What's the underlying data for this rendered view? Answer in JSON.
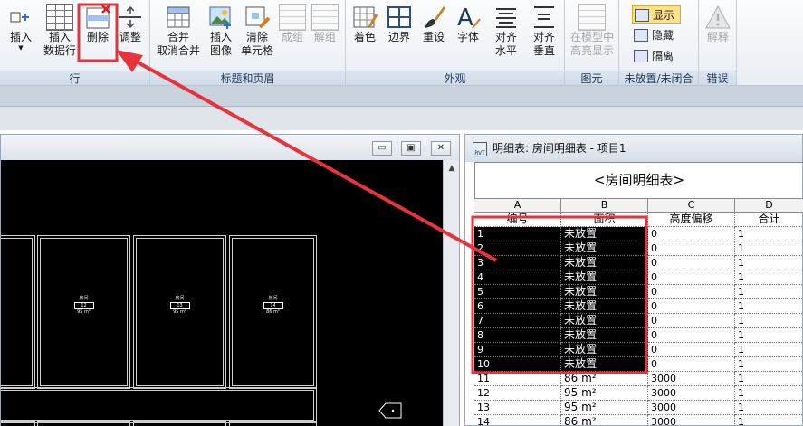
{
  "ribbon": {
    "groups": {
      "row": "行",
      "titles_headers": "标题和页眉",
      "appearance": "外观",
      "element": "图元",
      "unplaced": "未放置/未闭合",
      "error": "错误"
    },
    "buttons": {
      "insert": "插入",
      "insert_data_row_1": "插入",
      "insert_data_row_2": "数据行",
      "delete": "删除",
      "adjust": "调整",
      "merge_1": "合并",
      "merge_2": "取消合并",
      "insert_image_1": "插入",
      "insert_image_2": "图像",
      "clear_cell_1": "清除",
      "clear_cell_2": "单元格",
      "group": "成组",
      "ungroup": "解组",
      "shading": "着色",
      "borders": "边界",
      "reset": "重设",
      "font": "字体",
      "align_h_1": "对齐",
      "align_h_2": "水平",
      "align_v_1": "对齐",
      "align_v_2": "垂直",
      "highlight_model_1": "在模型中",
      "highlight_model_2": "高亮显示",
      "show": "显示",
      "hide": "隐藏",
      "isolate": "隔离",
      "explain": "解释"
    }
  },
  "view_window": {
    "buttons": {
      "minimize": "▭",
      "restore": "▣",
      "close": "✕"
    },
    "room_tags": [
      {
        "name": "房间",
        "number": "12",
        "area": "95 m²"
      },
      {
        "name": "房间",
        "number": "13",
        "area": "95 m²"
      },
      {
        "name": "房间",
        "number": "14",
        "area": "86 m²"
      }
    ]
  },
  "schedule": {
    "window_title": "明细表: 房间明细表 - 项目1",
    "icon_label": "RVT",
    "heading": "<房间明细表>",
    "column_letters": [
      "A",
      "B",
      "C",
      "D"
    ],
    "column_headers": [
      "编号",
      "面积",
      "高度偏移",
      "合计"
    ],
    "rows": [
      {
        "num": "1",
        "area": "未放置",
        "offset": "0",
        "count": "1",
        "selected": true
      },
      {
        "num": "2",
        "area": "未放置",
        "offset": "0",
        "count": "1",
        "selected": true
      },
      {
        "num": "3",
        "area": "未放置",
        "offset": "0",
        "count": "1",
        "selected": true
      },
      {
        "num": "4",
        "area": "未放置",
        "offset": "0",
        "count": "1",
        "selected": true
      },
      {
        "num": "5",
        "area": "未放置",
        "offset": "0",
        "count": "1",
        "selected": true
      },
      {
        "num": "6",
        "area": "未放置",
        "offset": "0",
        "count": "1",
        "selected": true
      },
      {
        "num": "7",
        "area": "未放置",
        "offset": "0",
        "count": "1",
        "selected": true
      },
      {
        "num": "8",
        "area": "未放置",
        "offset": "0",
        "count": "1",
        "selected": true
      },
      {
        "num": "9",
        "area": "未放置",
        "offset": "0",
        "count": "1",
        "selected": true
      },
      {
        "num": "10",
        "area": "未放置",
        "offset": "0",
        "count": "1",
        "selected": true
      },
      {
        "num": "11",
        "area": "86 m²",
        "offset": "3000",
        "count": "1",
        "selected": false
      },
      {
        "num": "12",
        "area": "95 m²",
        "offset": "3000",
        "count": "1",
        "selected": false
      },
      {
        "num": "13",
        "area": "95 m²",
        "offset": "3000",
        "count": "1",
        "selected": false
      },
      {
        "num": "14",
        "area": "86 m²",
        "offset": "3000",
        "count": "1",
        "selected": false
      }
    ]
  },
  "colors": {
    "annotation_red": "#e8323c",
    "selection": "#000000",
    "ribbon_group_text": "#1e395b"
  }
}
